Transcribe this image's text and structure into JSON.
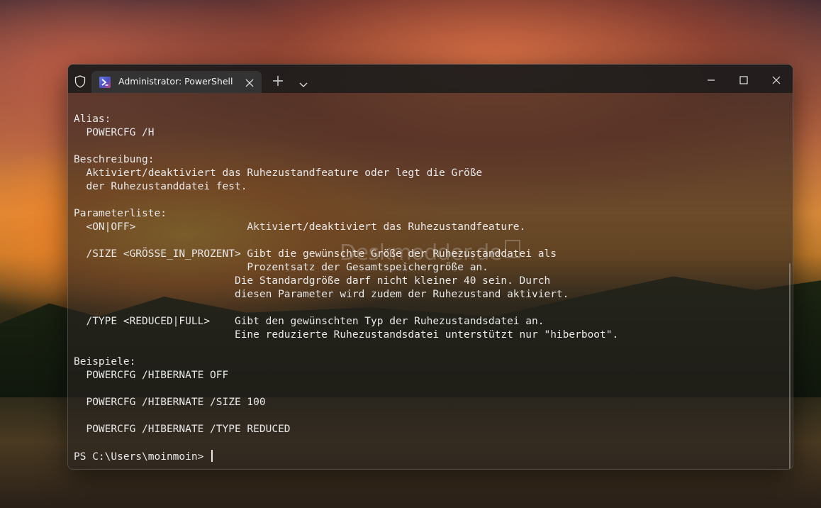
{
  "window": {
    "tab_title": "Administrator: PowerShell",
    "icons": {
      "shield": "shield-icon",
      "app": "powershell-icon",
      "close_tab": "close-icon",
      "new_tab": "plus-icon",
      "dropdown": "chevron-down-icon",
      "minimize": "minimize-icon",
      "maximize": "maximize-icon",
      "close": "close-icon"
    }
  },
  "terminal": {
    "lines": [
      "Alias:",
      "  POWERCFG /H",
      "",
      "Beschreibung:",
      "  Aktiviert/deaktiviert das Ruhezustandfeature oder legt die Größe",
      "  der Ruhezustanddatei fest.",
      "",
      "Parameterliste:",
      "  <ON|OFF>                  Aktiviert/deaktiviert das Ruhezustandfeature.",
      "",
      "  /SIZE <GRÖSSE_IN_PROZENT> Gibt die gewünschte Größe der Ruhezustanddatei als",
      "                            Prozentsatz der Gesamtspeichergröße an.",
      "                          Die Standardgröße darf nicht kleiner 40 sein. Durch",
      "                          diesen Parameter wird zudem der Ruhezustand aktiviert.",
      "",
      "  /TYPE <REDUCED|FULL>    Gibt den gewünschten Typ der Ruhezustandsdatei an.",
      "                          Eine reduzierte Ruhezustandsdatei unterstützt nur \"hiberboot\".",
      "",
      "Beispiele:",
      "  POWERCFG /HIBERNATE OFF",
      "",
      "  POWERCFG /HIBERNATE /SIZE 100",
      "",
      "  POWERCFG /HIBERNATE /TYPE REDUCED",
      ""
    ],
    "prompt": "PS C:\\Users\\moinmoin> "
  },
  "watermark": "Deskmodder.de",
  "colors": {
    "text": "#e8e8e8",
    "titlebar": "#1c1c1c",
    "tab": "#343434"
  }
}
